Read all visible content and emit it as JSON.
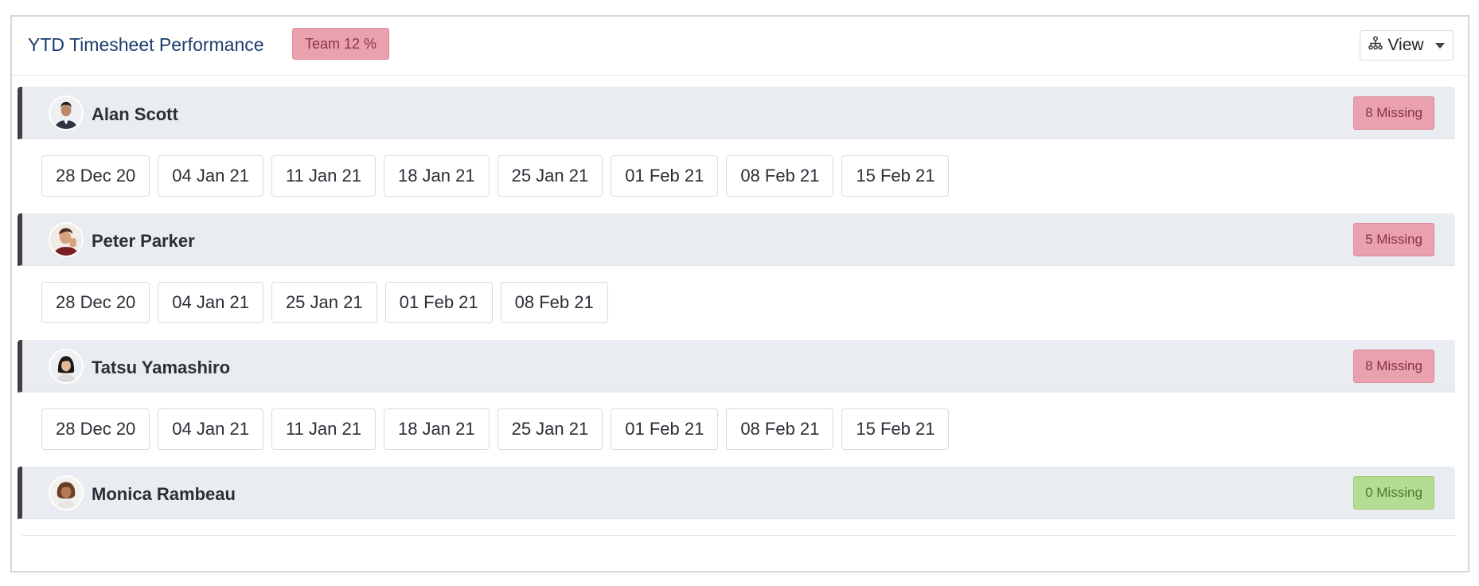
{
  "header": {
    "title": "YTD Timesheet Performance",
    "team_badge": "Team 12 %",
    "view_label": "View",
    "view_icon": "hierarchy-icon"
  },
  "colors": {
    "title": "#1d3c6b",
    "badge_red_bg": "#e9a1ae",
    "badge_green_bg": "#b5dc93",
    "row_bg": "#e9ecf1",
    "row_accent": "#3f3f41"
  },
  "people": [
    {
      "name": "Alan Scott",
      "missing": "8 Missing",
      "status": "red",
      "dates": [
        "28 Dec 20",
        "04 Jan 21",
        "11 Jan 21",
        "18 Jan 21",
        "25 Jan 21",
        "01 Feb 21",
        "08 Feb 21",
        "15 Feb 21"
      ]
    },
    {
      "name": "Peter Parker",
      "missing": "5 Missing",
      "status": "red",
      "dates": [
        "28 Dec 20",
        "04 Jan 21",
        "25 Jan 21",
        "01 Feb 21",
        "08 Feb 21"
      ]
    },
    {
      "name": "Tatsu Yamashiro",
      "missing": "8 Missing",
      "status": "red",
      "dates": [
        "28 Dec 20",
        "04 Jan 21",
        "11 Jan 21",
        "18 Jan 21",
        "25 Jan 21",
        "01 Feb 21",
        "08 Feb 21",
        "15 Feb 21"
      ]
    },
    {
      "name": "Monica Rambeau",
      "missing": "0 Missing",
      "status": "green",
      "dates": []
    }
  ]
}
